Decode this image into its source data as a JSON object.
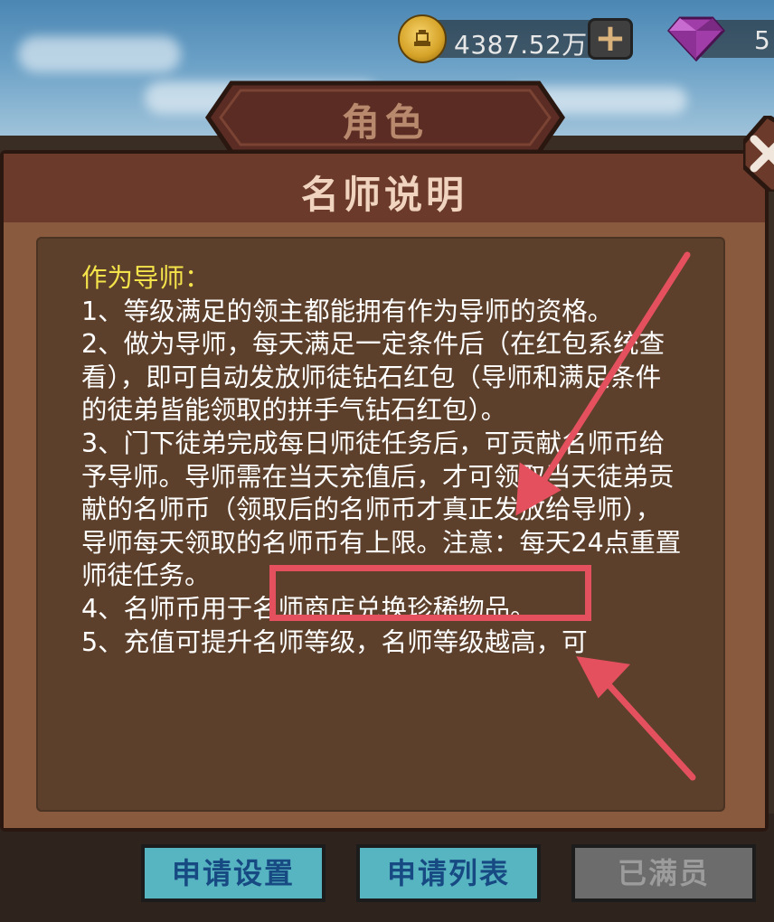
{
  "currency": {
    "gold_amount": "4387.52万",
    "gem_amount": "5",
    "icons": {
      "gold": "coin-icon",
      "gem": "gem-icon",
      "add": "plus-icon"
    }
  },
  "header": {
    "tab_title": "角色"
  },
  "dialog": {
    "title": "名师说明",
    "heading": "作为导师：",
    "lines": [
      "1、等级满足的领主都能拥有作为导师的资格。",
      "2、做为导师，每天满足一定条件后（在红包系统查看），即可自动发放师徒钻石红包（导师和满足条件的徒弟皆能领取的拼手气钻石红包）。",
      "3、门下徒弟完成每日师徒任务后，可贡献名师币给予导师。导师需在当天充值后，才可领取当天徒弟贡献的名师币（领取后的名师币才真正发放给导师），导师每天领取的名师币有上限。注意：每天24点重置师徒任务。",
      "4、名师币用于名师商店兑换珍稀物品。",
      "5、充值可提升名师等级，名师等级越高，可"
    ],
    "highlight_text": "导师需在当天充值后，",
    "close_icon": "close-icon"
  },
  "buttons": {
    "apply_settings": "申请设置",
    "apply_list": "申请列表",
    "full": "已满员"
  },
  "colors": {
    "accent_red": "#e5505e",
    "heading_yellow": "#f4e34a",
    "button_blue": "#57b5c2"
  }
}
